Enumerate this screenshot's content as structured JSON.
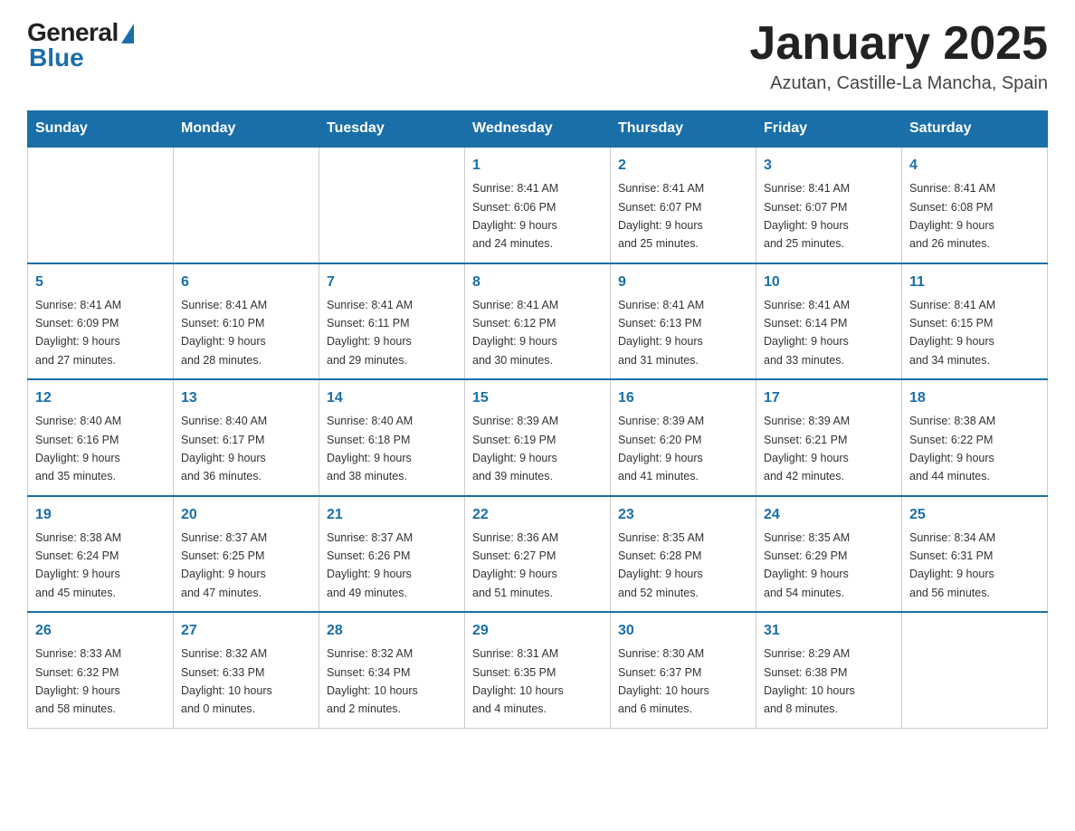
{
  "header": {
    "logo_general": "General",
    "logo_blue": "Blue",
    "month_title": "January 2025",
    "location": "Azutan, Castille-La Mancha, Spain"
  },
  "days_of_week": [
    "Sunday",
    "Monday",
    "Tuesday",
    "Wednesday",
    "Thursday",
    "Friday",
    "Saturday"
  ],
  "weeks": [
    [
      {
        "day": "",
        "info": ""
      },
      {
        "day": "",
        "info": ""
      },
      {
        "day": "",
        "info": ""
      },
      {
        "day": "1",
        "info": "Sunrise: 8:41 AM\nSunset: 6:06 PM\nDaylight: 9 hours\nand 24 minutes."
      },
      {
        "day": "2",
        "info": "Sunrise: 8:41 AM\nSunset: 6:07 PM\nDaylight: 9 hours\nand 25 minutes."
      },
      {
        "day": "3",
        "info": "Sunrise: 8:41 AM\nSunset: 6:07 PM\nDaylight: 9 hours\nand 25 minutes."
      },
      {
        "day": "4",
        "info": "Sunrise: 8:41 AM\nSunset: 6:08 PM\nDaylight: 9 hours\nand 26 minutes."
      }
    ],
    [
      {
        "day": "5",
        "info": "Sunrise: 8:41 AM\nSunset: 6:09 PM\nDaylight: 9 hours\nand 27 minutes."
      },
      {
        "day": "6",
        "info": "Sunrise: 8:41 AM\nSunset: 6:10 PM\nDaylight: 9 hours\nand 28 minutes."
      },
      {
        "day": "7",
        "info": "Sunrise: 8:41 AM\nSunset: 6:11 PM\nDaylight: 9 hours\nand 29 minutes."
      },
      {
        "day": "8",
        "info": "Sunrise: 8:41 AM\nSunset: 6:12 PM\nDaylight: 9 hours\nand 30 minutes."
      },
      {
        "day": "9",
        "info": "Sunrise: 8:41 AM\nSunset: 6:13 PM\nDaylight: 9 hours\nand 31 minutes."
      },
      {
        "day": "10",
        "info": "Sunrise: 8:41 AM\nSunset: 6:14 PM\nDaylight: 9 hours\nand 33 minutes."
      },
      {
        "day": "11",
        "info": "Sunrise: 8:41 AM\nSunset: 6:15 PM\nDaylight: 9 hours\nand 34 minutes."
      }
    ],
    [
      {
        "day": "12",
        "info": "Sunrise: 8:40 AM\nSunset: 6:16 PM\nDaylight: 9 hours\nand 35 minutes."
      },
      {
        "day": "13",
        "info": "Sunrise: 8:40 AM\nSunset: 6:17 PM\nDaylight: 9 hours\nand 36 minutes."
      },
      {
        "day": "14",
        "info": "Sunrise: 8:40 AM\nSunset: 6:18 PM\nDaylight: 9 hours\nand 38 minutes."
      },
      {
        "day": "15",
        "info": "Sunrise: 8:39 AM\nSunset: 6:19 PM\nDaylight: 9 hours\nand 39 minutes."
      },
      {
        "day": "16",
        "info": "Sunrise: 8:39 AM\nSunset: 6:20 PM\nDaylight: 9 hours\nand 41 minutes."
      },
      {
        "day": "17",
        "info": "Sunrise: 8:39 AM\nSunset: 6:21 PM\nDaylight: 9 hours\nand 42 minutes."
      },
      {
        "day": "18",
        "info": "Sunrise: 8:38 AM\nSunset: 6:22 PM\nDaylight: 9 hours\nand 44 minutes."
      }
    ],
    [
      {
        "day": "19",
        "info": "Sunrise: 8:38 AM\nSunset: 6:24 PM\nDaylight: 9 hours\nand 45 minutes."
      },
      {
        "day": "20",
        "info": "Sunrise: 8:37 AM\nSunset: 6:25 PM\nDaylight: 9 hours\nand 47 minutes."
      },
      {
        "day": "21",
        "info": "Sunrise: 8:37 AM\nSunset: 6:26 PM\nDaylight: 9 hours\nand 49 minutes."
      },
      {
        "day": "22",
        "info": "Sunrise: 8:36 AM\nSunset: 6:27 PM\nDaylight: 9 hours\nand 51 minutes."
      },
      {
        "day": "23",
        "info": "Sunrise: 8:35 AM\nSunset: 6:28 PM\nDaylight: 9 hours\nand 52 minutes."
      },
      {
        "day": "24",
        "info": "Sunrise: 8:35 AM\nSunset: 6:29 PM\nDaylight: 9 hours\nand 54 minutes."
      },
      {
        "day": "25",
        "info": "Sunrise: 8:34 AM\nSunset: 6:31 PM\nDaylight: 9 hours\nand 56 minutes."
      }
    ],
    [
      {
        "day": "26",
        "info": "Sunrise: 8:33 AM\nSunset: 6:32 PM\nDaylight: 9 hours\nand 58 minutes."
      },
      {
        "day": "27",
        "info": "Sunrise: 8:32 AM\nSunset: 6:33 PM\nDaylight: 10 hours\nand 0 minutes."
      },
      {
        "day": "28",
        "info": "Sunrise: 8:32 AM\nSunset: 6:34 PM\nDaylight: 10 hours\nand 2 minutes."
      },
      {
        "day": "29",
        "info": "Sunrise: 8:31 AM\nSunset: 6:35 PM\nDaylight: 10 hours\nand 4 minutes."
      },
      {
        "day": "30",
        "info": "Sunrise: 8:30 AM\nSunset: 6:37 PM\nDaylight: 10 hours\nand 6 minutes."
      },
      {
        "day": "31",
        "info": "Sunrise: 8:29 AM\nSunset: 6:38 PM\nDaylight: 10 hours\nand 8 minutes."
      },
      {
        "day": "",
        "info": ""
      }
    ]
  ]
}
